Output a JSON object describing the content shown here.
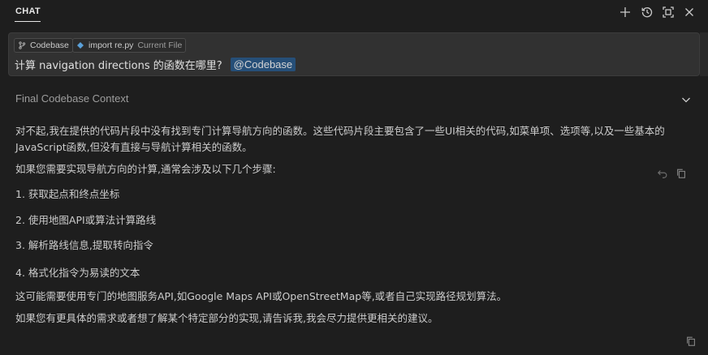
{
  "header": {
    "tab_label": "CHAT",
    "icons": [
      "plus-icon",
      "history-icon",
      "maximize-icon",
      "close-icon"
    ]
  },
  "input": {
    "chips": [
      {
        "icon": "branch-icon",
        "label": "Codebase"
      },
      {
        "icon": "file-icon",
        "label": "import re.py",
        "sub": "Current File"
      }
    ],
    "query_text": "计算 navigation directions 的函数在哪里?",
    "mention": "@Codebase"
  },
  "context": {
    "label": "Final Codebase Context"
  },
  "response": {
    "para1_line1": "对不起,我在提供的代码片段中没有找到专门计算导航方向的函数。这些代码片段主要包含了一些UI相关的代码,如菜单项、选项等,以及一些基本的",
    "para1_line2": "JavaScript函数,但没有直接与导航计算相关的函数。",
    "intro": "如果您需要实现导航方向的计算,通常会涉及以下几个步骤:",
    "steps": [
      "1. 获取起点和终点坐标",
      "2. 使用地图API或算法计算路线",
      "3. 解析路线信息,提取转向指令",
      "4. 格式化指令为易读的文本"
    ],
    "note": "这可能需要使用专门的地图服务API,如Google Maps API或OpenStreetMap等,或者自己实现路径规划算法。",
    "closing": "如果您有更具体的需求或者想了解某个特定部分的实现,请告诉我,我会尽力提供更相关的建议。"
  },
  "colors": {
    "background": "#1e1e1e",
    "input_background": "#313131",
    "mention_background": "#264f78",
    "text": "#cccccc",
    "muted_text": "#9d9d9d"
  }
}
